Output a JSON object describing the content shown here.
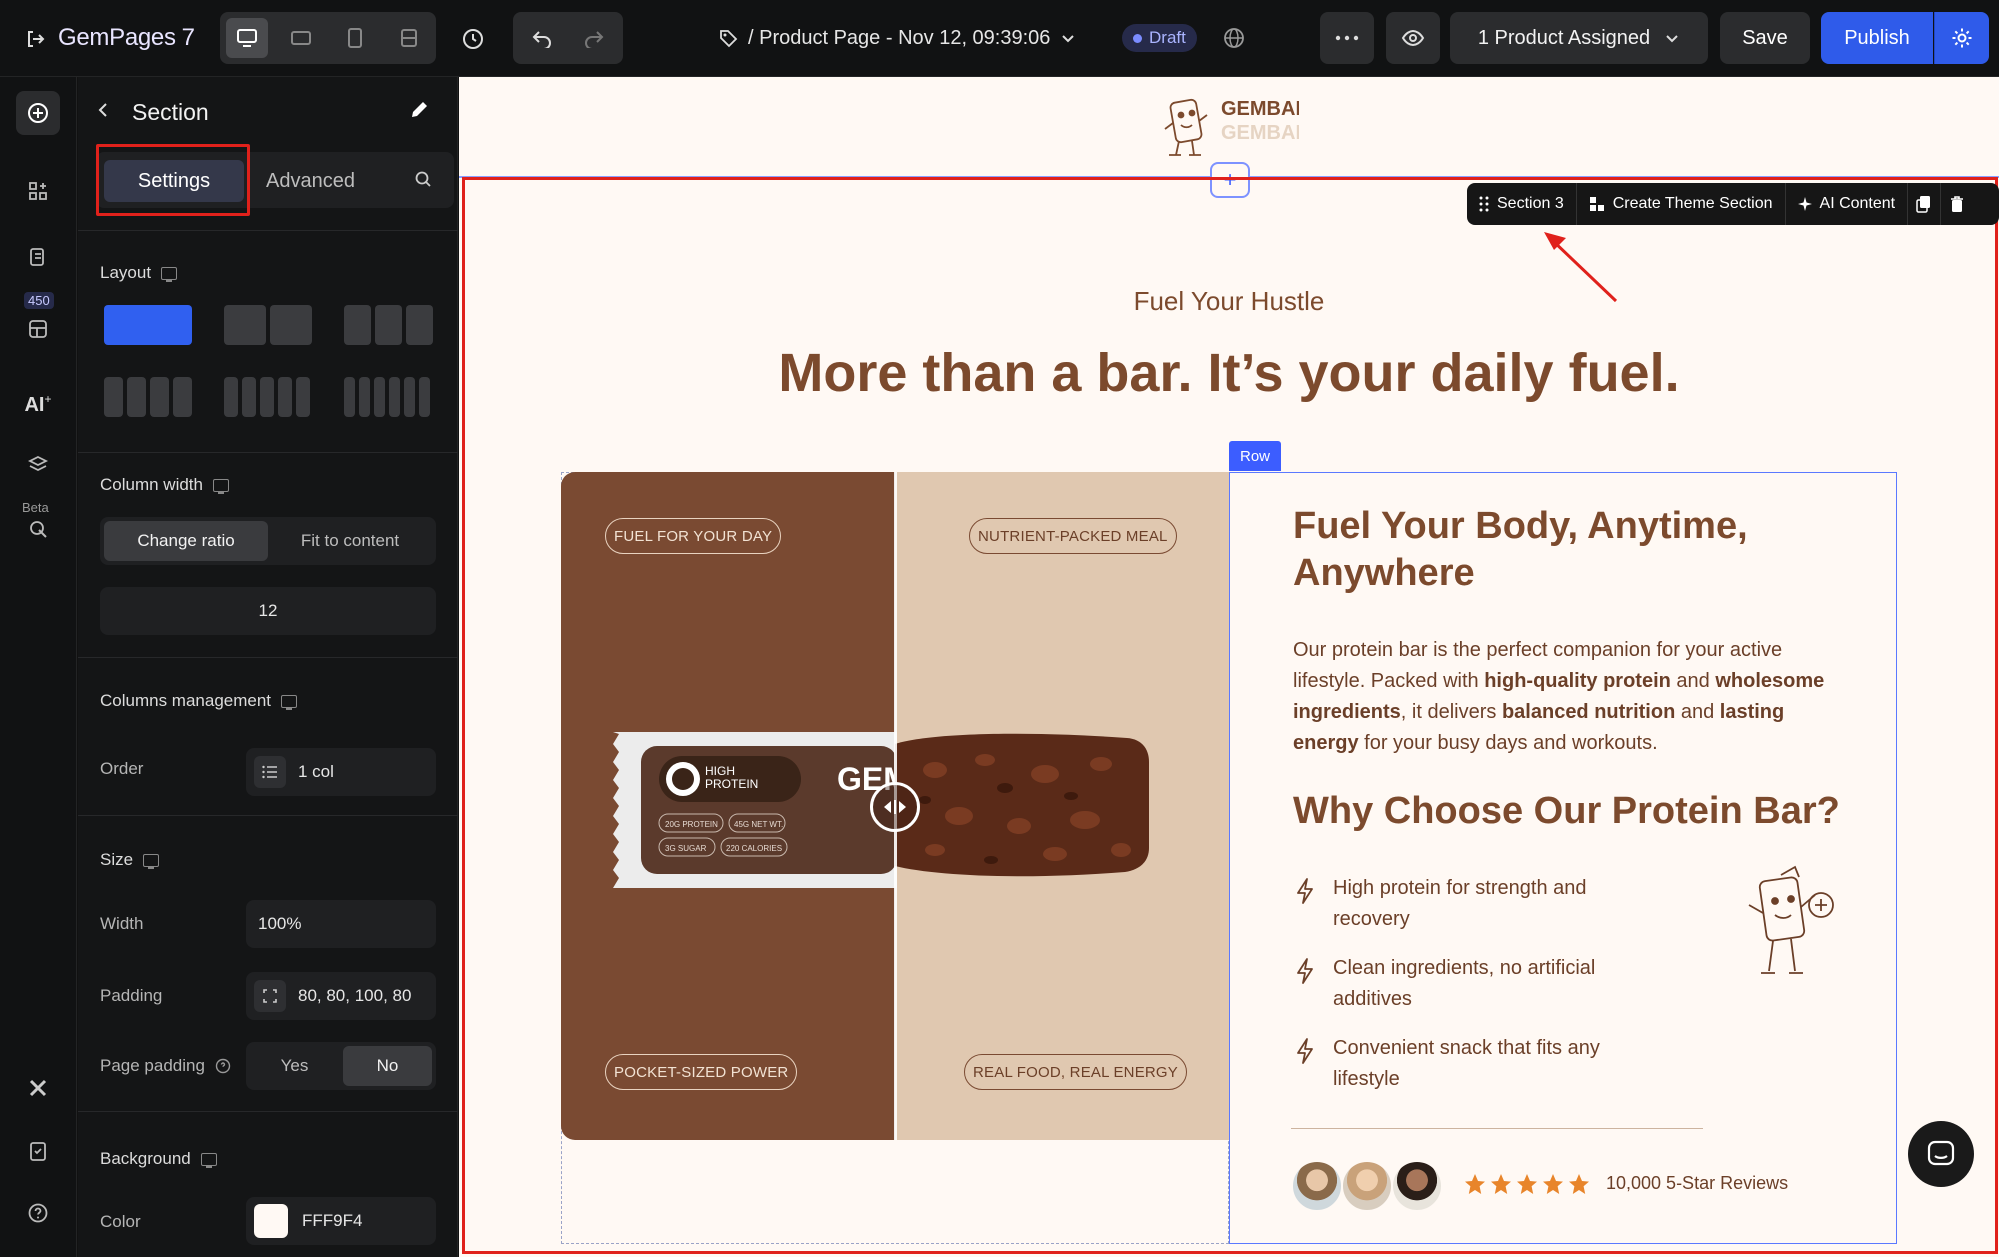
{
  "app": {
    "brand": "GemPages",
    "brand_version": "7",
    "page_title": "/ Product Page - Nov 12, 09:39:06",
    "status": "Draft",
    "product_assigned": "1 Product Assigned",
    "save_label": "Save",
    "publish_label": "Publish"
  },
  "rail": {
    "badge_count": "450",
    "ai_label": "AI",
    "beta_label": "Beta"
  },
  "panel": {
    "title": "Section",
    "tabs": {
      "settings": "Settings",
      "advanced": "Advanced"
    },
    "layout_label": "Layout",
    "column_width_label": "Column width",
    "column_width_options": [
      "Change ratio",
      "Fit to content"
    ],
    "column_width_value": "12",
    "columns_management_label": "Columns management",
    "order_label": "Order",
    "order_value": "1 col",
    "size_label": "Size",
    "width_label": "Width",
    "width_value": "100%",
    "padding_label": "Padding",
    "padding_value": "80, 80, 100, 80",
    "page_padding_label": "Page padding",
    "page_padding_options": [
      "Yes",
      "No"
    ],
    "page_padding_selected": "No",
    "background_label": "Background",
    "color_label": "Color",
    "color_value": "FFF9F4"
  },
  "canvas": {
    "logo_text": "GEMBAR",
    "section_toolbar": {
      "section_name": "Section 3",
      "create_theme": "Create Theme Section",
      "ai_content": "AI Content"
    },
    "eyebrow": "Fuel Your Hustle",
    "headline": "More than a bar. It’s your daily fuel.",
    "image": {
      "tag_top_left": "FUEL FOR YOUR DAY",
      "tag_top_right": "NUTRIENT-PACKED MEAL",
      "tag_bottom_left": "POCKET-SIZED POWER",
      "tag_bottom_right": "REAL FOOD, REAL ENERGY",
      "wrapper_high": "HIGH",
      "wrapper_protein": "PROTEIN",
      "wrapper_brand": "GEM",
      "wrapper_stats": [
        "20G PROTEIN",
        "45G NET WT.",
        "3G SUGAR",
        "220 CALORIES"
      ]
    },
    "row_tag": "Row",
    "content": {
      "title": "Fuel Your Body, Anytime, Anywhere",
      "para_1": "Our protein bar is the perfect companion for your active lifestyle. Packed with ",
      "para_b1": "high-quality protein",
      "para_2": " and ",
      "para_b2": "wholesome ingredients",
      "para_3": ", it delivers ",
      "para_b3": "balanced nutrition",
      "para_4": " and ",
      "para_b4": "lasting energy",
      "para_5": " for your busy days and workouts.",
      "why_title": "Why Choose Our Protein Bar?",
      "features": [
        "High protein for strength and recovery",
        "Clean ingredients, no artificial additives",
        "Convenient snack that fits any lifestyle"
      ],
      "reviews": "10,000 5-Star Reviews",
      "rating": 5
    }
  },
  "colors": {
    "brand_brown": "#7c4a2d",
    "canvas_bg": "#fff9f4",
    "publish_blue": "#2f5bea",
    "selection_red": "#e0211b",
    "row_blue": "#5b79ff",
    "star_orange": "#e8852b"
  }
}
